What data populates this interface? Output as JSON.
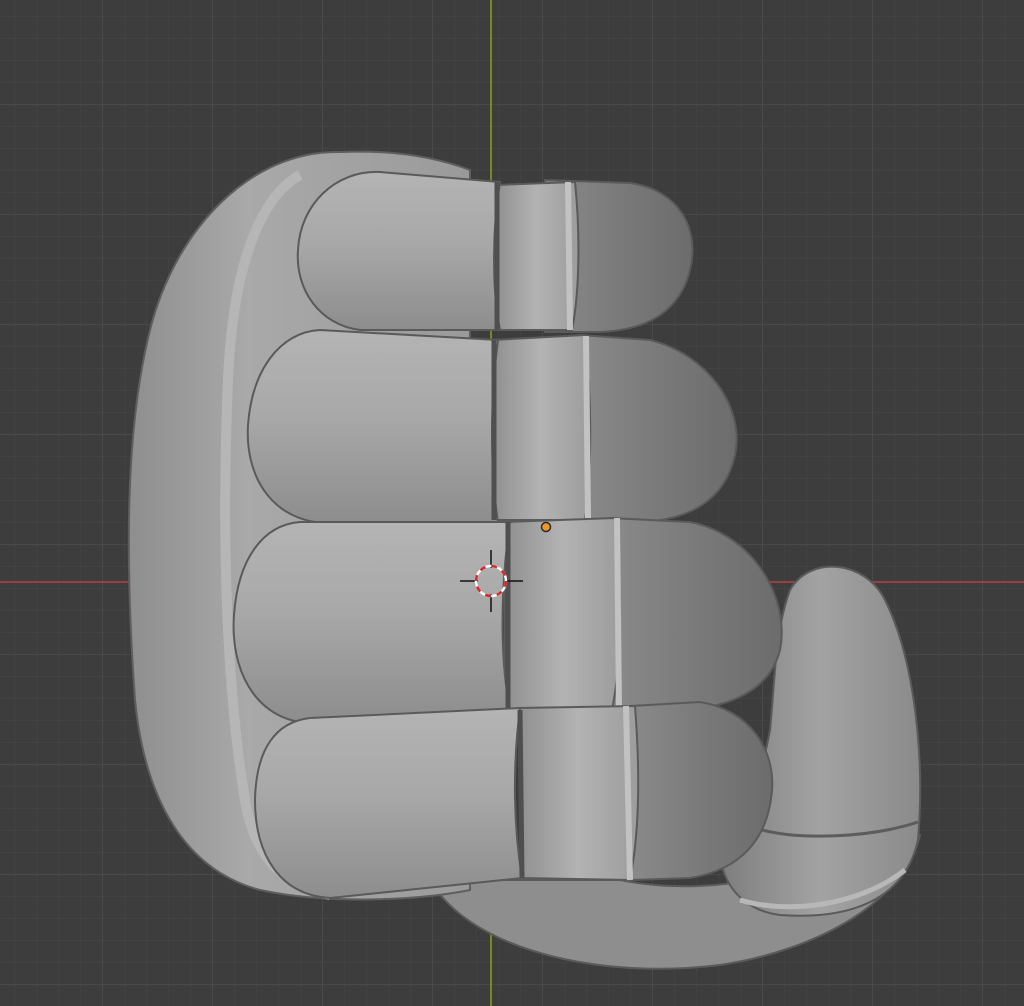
{
  "viewport": {
    "name": "3d-viewport",
    "background": "#3d3d3d",
    "grid_minor_color": "#474747",
    "grid_major_color": "#4f4f4f",
    "x_axis_color": "#b3414a",
    "y_axis_color": "#88a31f",
    "scene_object": "fist-mesh",
    "shading": "solid",
    "mesh_color": "#a7a7a7"
  },
  "cursor": {
    "icon": "3d-cursor-icon",
    "ring_colors": [
      "#ffffff",
      "#d9272e"
    ]
  },
  "origin": {
    "icon": "object-origin-icon",
    "color": "#f2962a"
  }
}
